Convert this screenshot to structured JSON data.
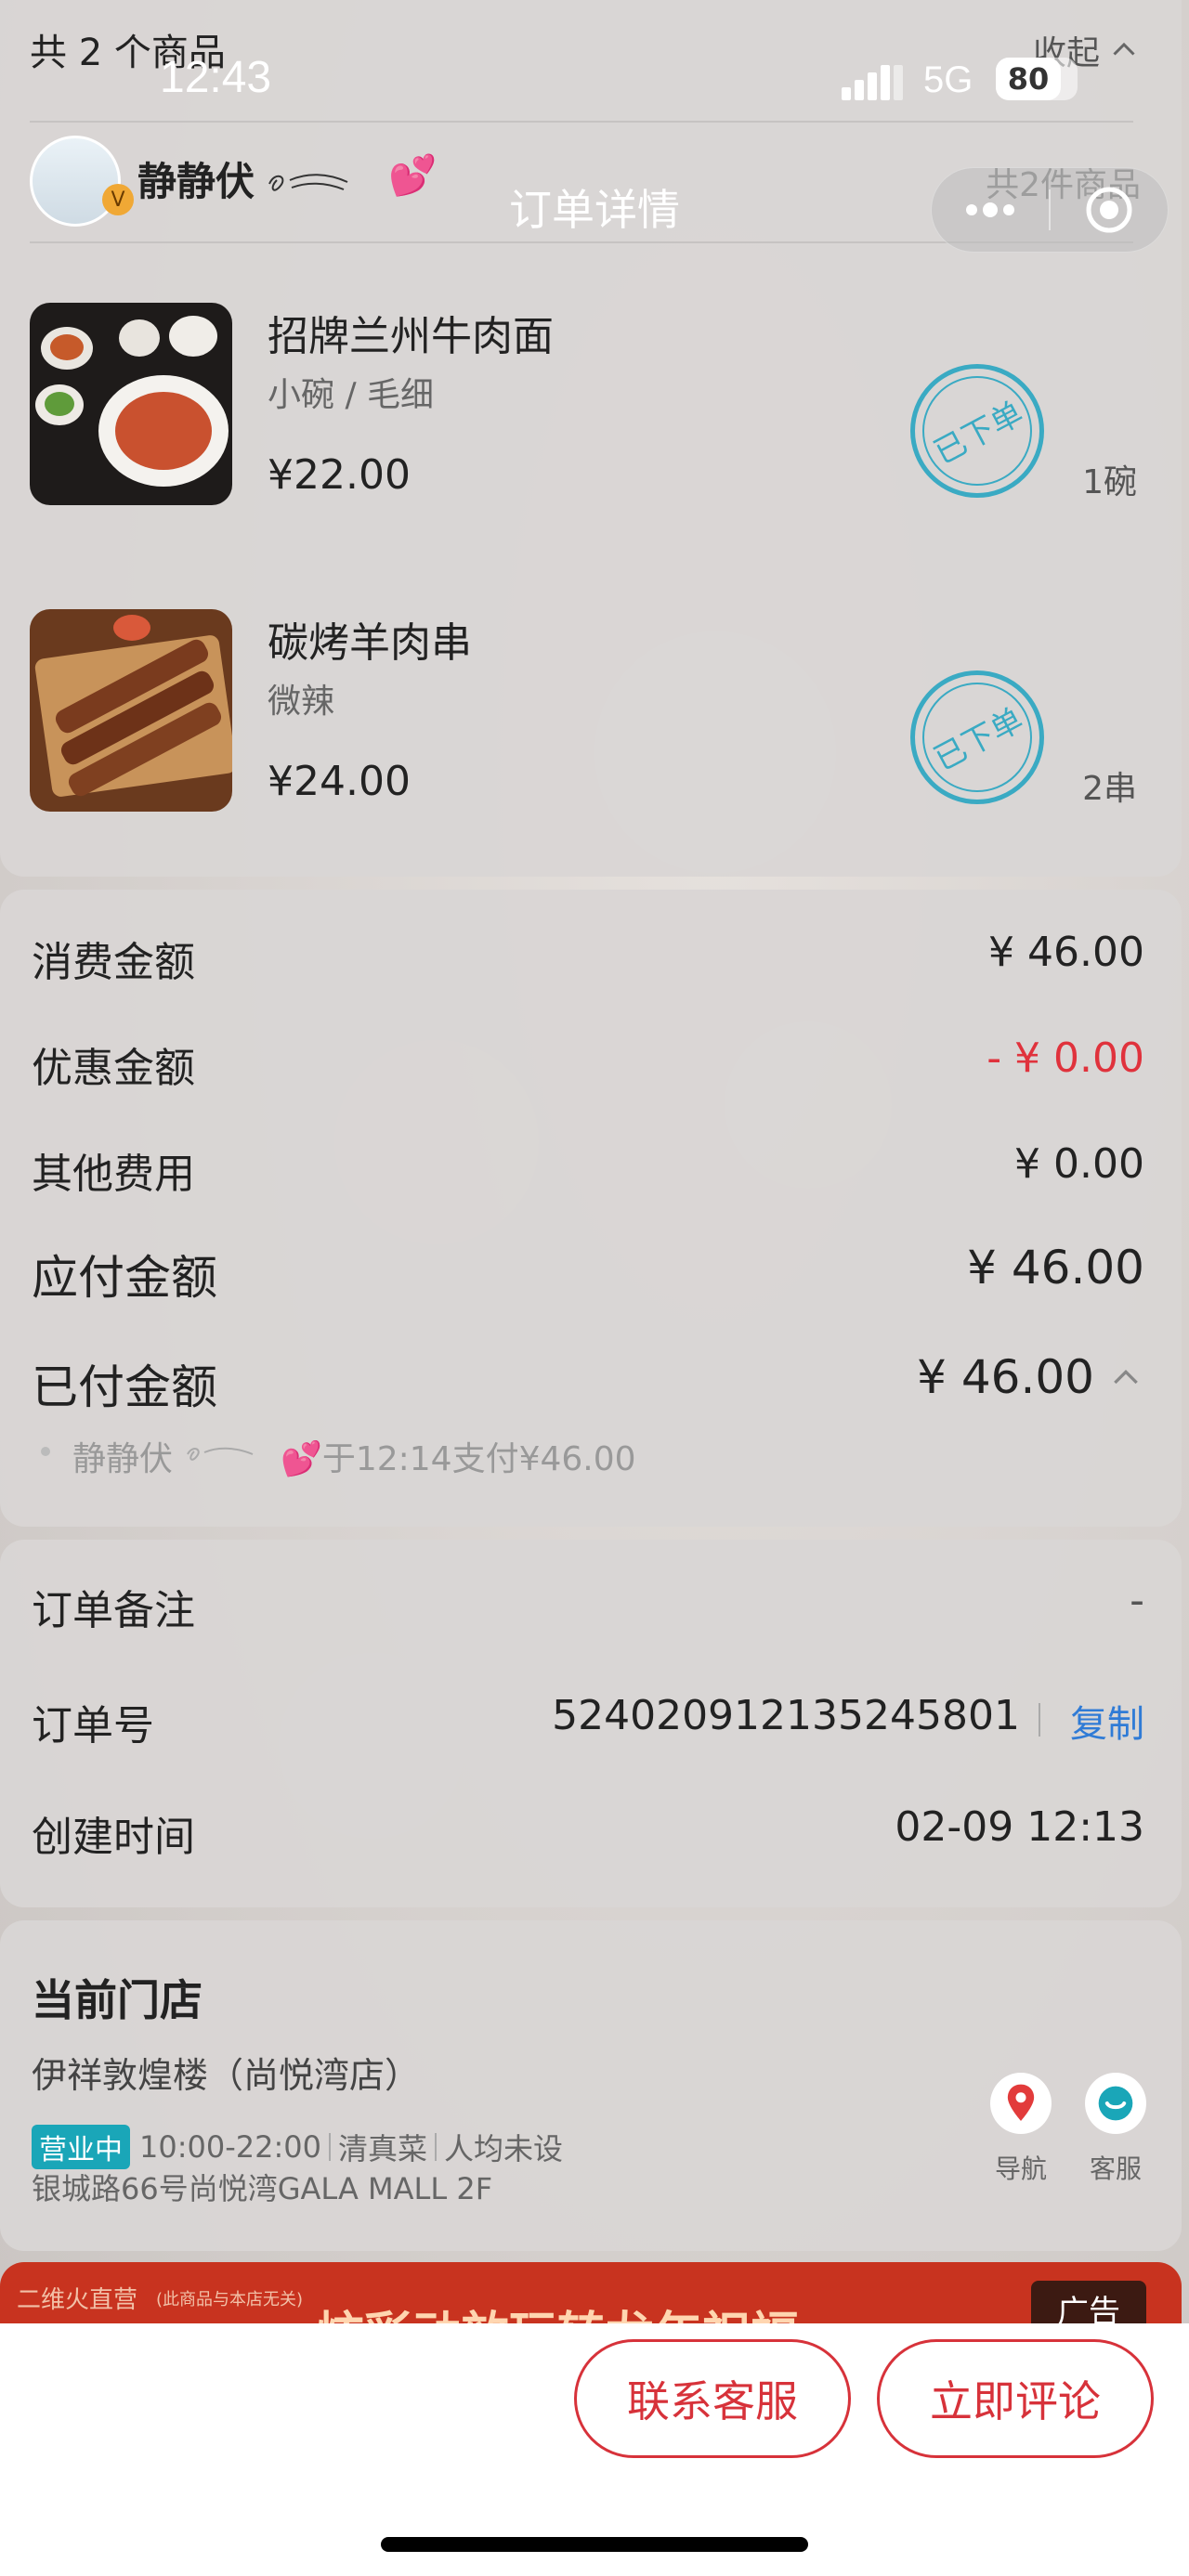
{
  "status_bar": {
    "time": "12:43",
    "network": "5G",
    "battery": "80"
  },
  "nav": {
    "title": "订单详情"
  },
  "items_header": {
    "count_text": "共 2 个商品",
    "collapse_label": "收起"
  },
  "customer": {
    "name": "静静伏",
    "deco": "💕",
    "badge": "V",
    "summary": "共2件商品"
  },
  "products": [
    {
      "name": "招牌兰州牛肉面",
      "spec": "小碗 / 毛细",
      "price": "¥22.00",
      "stamp": "已下单",
      "qty": "1碗"
    },
    {
      "name": "碳烤羊肉串",
      "spec": "微辣",
      "price": "¥24.00",
      "stamp": "已下单",
      "qty": "2串"
    }
  ],
  "amounts": {
    "consume_label": "消费金额",
    "consume_value": "¥ 46.00",
    "discount_label": "优惠金额",
    "discount_value": "- ¥ 0.00",
    "other_label": "其他费用",
    "other_value": "¥ 0.00",
    "payable_label": "应付金额",
    "payable_value": "¥ 46.00",
    "paid_label": "已付金额",
    "paid_value": "¥ 46.00",
    "payment_note_name": "静静伏",
    "payment_note_text": "💕于12:14支付¥46.00"
  },
  "order": {
    "remark_label": "订单备注",
    "remark_value": "-",
    "number_label": "订单号",
    "number_value": "524020912135245801",
    "copy_label": "复制",
    "created_label": "创建时间",
    "created_value": "02-09 12:13"
  },
  "store": {
    "section_title": "当前门店",
    "name": "伊祥敦煌楼（尚悦湾店）",
    "status": "营业中",
    "hours": "10:00-22:00",
    "category": "清真菜",
    "avg": "人均未设",
    "address": "银城路66号尚悦湾GALA MALL 2F",
    "nav_label": "导航",
    "service_label": "客服"
  },
  "ad": {
    "left_text": "二维火直营",
    "left_sub": "(此商品与本店无关)",
    "center_text": "炫彩动效玩转龙年祝福",
    "tag": "广告"
  },
  "actions": {
    "contact": "联系客服",
    "review": "立即评论"
  },
  "colors": {
    "accent_red": "#d7323a",
    "link_blue": "#2f7bd6",
    "stamp_teal": "#3aaac3",
    "status_green": "#1aa6b8"
  }
}
